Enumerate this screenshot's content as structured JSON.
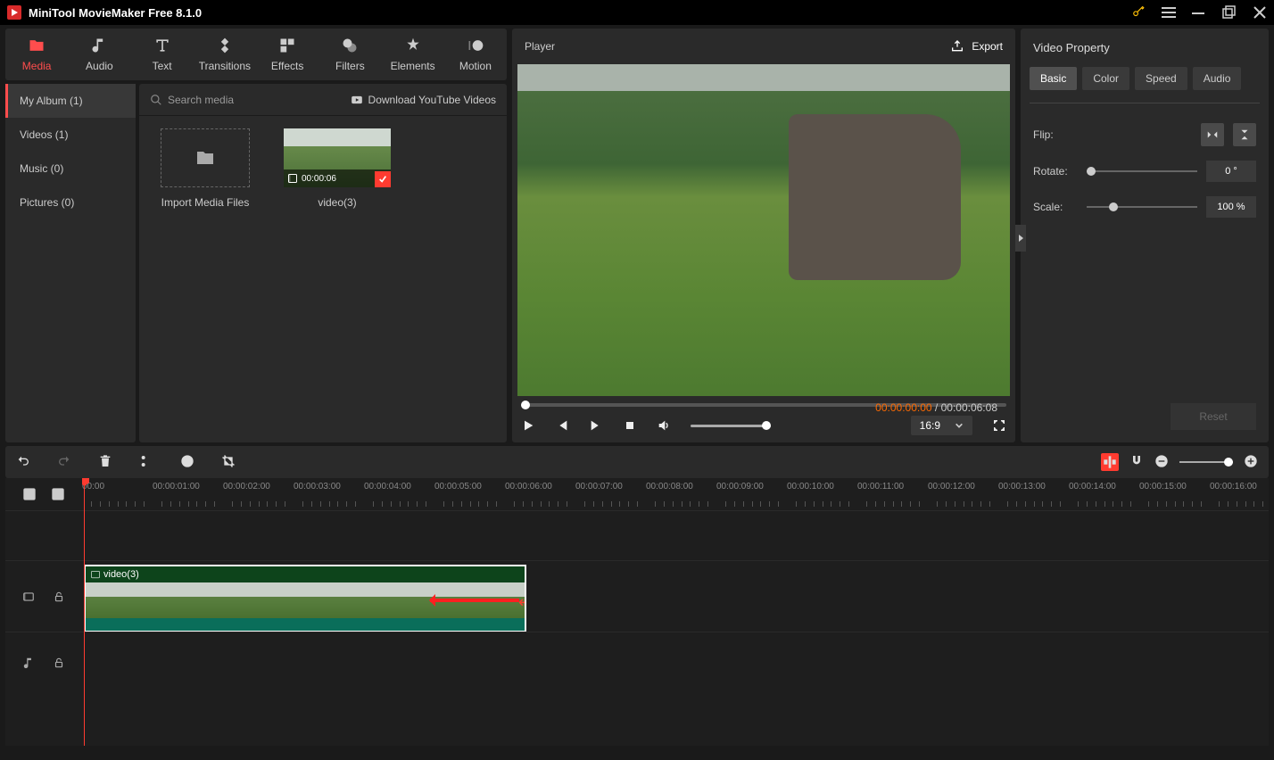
{
  "app": {
    "title": "MiniTool MovieMaker Free 8.1.0"
  },
  "tabs": {
    "media": "Media",
    "audio": "Audio",
    "text": "Text",
    "transitions": "Transitions",
    "effects": "Effects",
    "filters": "Filters",
    "elements": "Elements",
    "motion": "Motion"
  },
  "albums": {
    "my_album": "My Album (1)",
    "videos": "Videos (1)",
    "music": "Music (0)",
    "pictures": "Pictures (0)"
  },
  "media_toolbar": {
    "search_placeholder": "Search media",
    "download": "Download YouTube Videos"
  },
  "media_cards": {
    "import": "Import Media Files",
    "clip1_name": "video(3)",
    "clip1_duration": "00:00:06"
  },
  "player": {
    "title": "Player",
    "export": "Export",
    "time_current": "00:00:00:00",
    "time_total": "00:00:06:08",
    "aspect": "16:9"
  },
  "property": {
    "title": "Video Property",
    "tabs": {
      "basic": "Basic",
      "color": "Color",
      "speed": "Speed",
      "audio": "Audio"
    },
    "flip": "Flip:",
    "rotate": "Rotate:",
    "rotate_val": "0 °",
    "scale": "Scale:",
    "scale_val": "100 %",
    "reset": "Reset"
  },
  "timeline": {
    "ticks": [
      "00:00",
      "00:00:01:00",
      "00:00:02:00",
      "00:00:03:00",
      "00:00:04:00",
      "00:00:05:00",
      "00:00:06:00",
      "00:00:07:00",
      "00:00:08:00",
      "00:00:09:00",
      "00:00:10:00",
      "00:00:11:00",
      "00:00:12:00",
      "00:00:13:00",
      "00:00:14:00",
      "00:00:15:00",
      "00:00:16:00"
    ],
    "clip_name": "video(3)"
  }
}
